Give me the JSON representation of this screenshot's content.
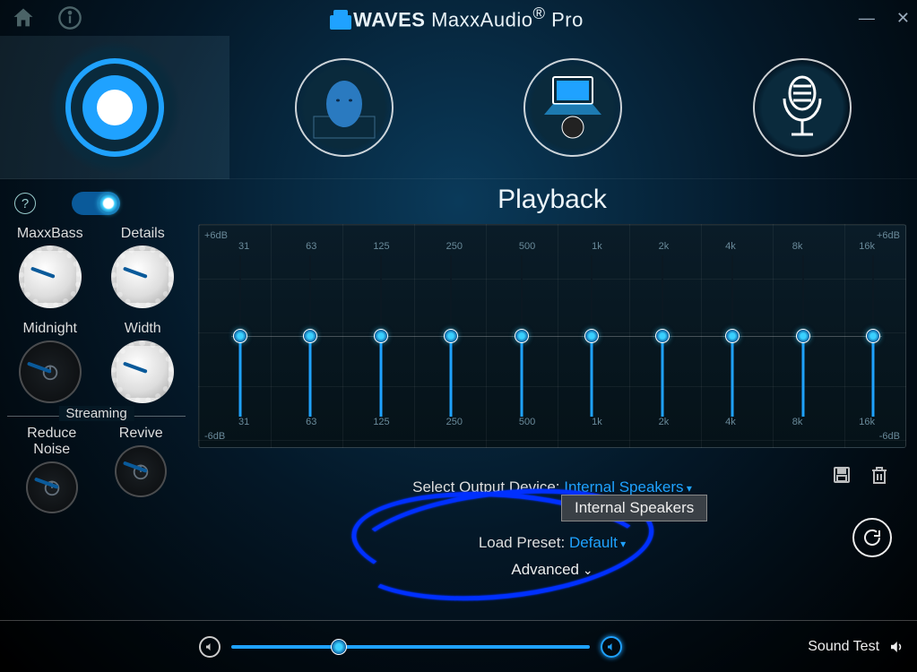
{
  "brand": {
    "strong": "WAVES",
    "light1": "MaxxAudio",
    "light2": "Pro",
    "reg": "®"
  },
  "window": {
    "minimize": "—",
    "close": "✕"
  },
  "modes": [
    "Playback",
    "Voice",
    "Conference",
    "Recording"
  ],
  "section_title": "Playback",
  "help": "?",
  "knobs": {
    "maxxbass": "MaxxBass",
    "details": "Details",
    "midnight": "Midnight",
    "width": "Width"
  },
  "streaming": {
    "label": "Streaming",
    "reduce_noise": "Reduce\nNoise",
    "revive": "Revive"
  },
  "eq": {
    "bands": [
      "31",
      "63",
      "125",
      "250",
      "500",
      "1k",
      "2k",
      "4k",
      "8k",
      "16k"
    ],
    "db_plus": "+6dB",
    "db_minus": "-6dB"
  },
  "device": {
    "label": "Select Output Device:",
    "value": "Internal Speakers",
    "dropdown_item": "Internal Speakers"
  },
  "preset": {
    "label": "Load Preset:",
    "value": "Default"
  },
  "advanced": "Advanced",
  "sound_test": "Sound Test",
  "balance": {
    "value": 30
  }
}
